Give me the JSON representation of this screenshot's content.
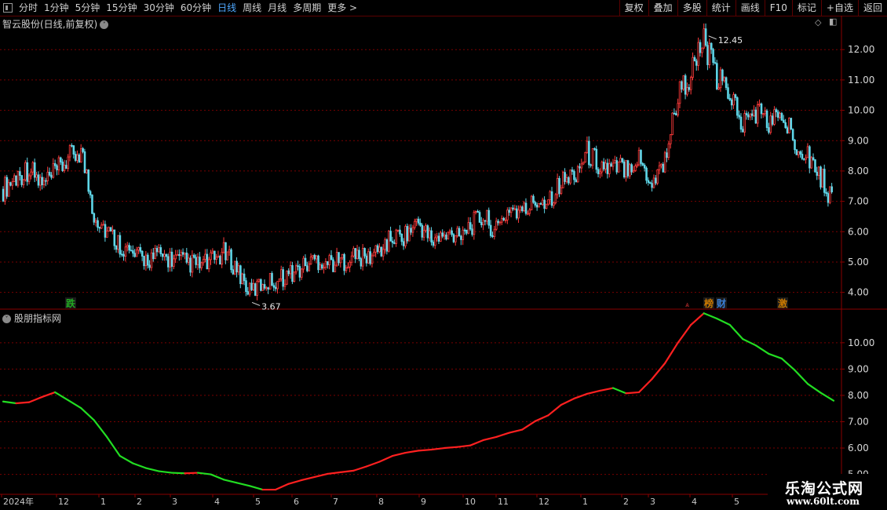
{
  "toolbar": {
    "periods": [
      "分时",
      "1分钟",
      "5分钟",
      "15分钟",
      "30分钟",
      "60分钟",
      "日线",
      "周线",
      "月线",
      "多周期",
      "更多 >"
    ],
    "active": "日线",
    "right_buttons": [
      "复权",
      "叠加",
      "多股",
      "统计",
      "画线",
      "F10",
      "标记",
      "+自选",
      "返回"
    ]
  },
  "main_panel": {
    "title": "智云股份(日线,前复权)",
    "y_ticks": [
      "12.00",
      "11.00",
      "10.00",
      "9.00",
      "8.00",
      "7.00",
      "6.00",
      "5.00",
      "4.00"
    ],
    "high_label": "12.45",
    "low_label": "3.67",
    "markers": [
      {
        "text": "跌",
        "color": "#22aa22",
        "date_index": 0
      },
      {
        "text": "榜",
        "color": "#cc7a00",
        "date_index": 1
      },
      {
        "text": "财",
        "color": "#3a7fd5",
        "date_index": 2
      },
      {
        "text": "激",
        "color": "#cc7a00",
        "date_index": 3
      }
    ],
    "colors": {
      "up": "#ff3b3b",
      "down": "#5fd6e8",
      "grid": "#7a0000"
    }
  },
  "indicator_panel": {
    "title": "股朋指标网",
    "y_ticks": [
      "10.00",
      "9.00",
      "8.00",
      "7.00",
      "6.00",
      "5.00"
    ],
    "colors": {
      "rise": "#ff2020",
      "fall": "#22dd22"
    }
  },
  "time_axis": {
    "labels": [
      "2024年",
      "12",
      "1",
      "2",
      "3",
      "4",
      "5",
      "6",
      "7",
      "8",
      "9",
      "10",
      "11",
      "12",
      "1",
      "2",
      "3",
      "4",
      "5"
    ]
  },
  "watermark": {
    "line1": "乐淘公式网",
    "line2": "www.60lt.com"
  },
  "chart_data": {
    "type": "candlestick",
    "ylim": [
      3.5,
      12.6
    ],
    "series": [
      {
        "name": "price_close",
        "values": [
          7.4,
          7.8,
          8.1,
          7.5,
          7.9,
          8.4,
          8.7,
          6.6,
          6.0,
          5.6,
          5.2,
          5.1,
          5.2,
          5.1,
          5.0,
          4.9,
          5.0,
          5.3,
          4.8,
          4.0,
          4.3,
          4.4,
          4.6,
          4.8,
          5.1,
          5.0,
          5.0,
          5.2,
          5.1,
          5.4,
          5.8,
          5.9,
          6.3,
          5.7,
          5.8,
          6.0,
          6.2,
          6.5,
          6.0,
          6.8,
          6.6,
          7.0,
          7.1,
          7.6,
          7.9,
          8.6,
          8.2,
          8.0,
          8.2,
          8.4,
          7.6,
          8.4,
          10.5,
          11.2,
          12.3,
          11.0,
          10.6,
          9.5,
          10.0,
          9.6,
          9.8,
          9.0,
          8.6,
          7.8,
          7.0
        ]
      }
    ]
  }
}
